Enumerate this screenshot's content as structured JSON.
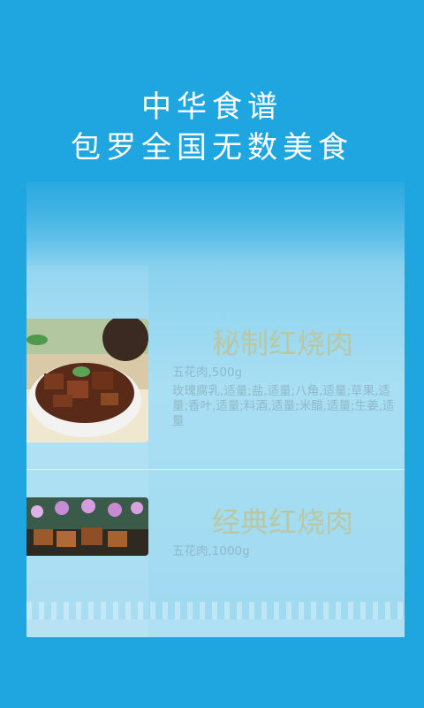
{
  "headline": {
    "line1": "中华食谱",
    "line2": "包罗全国无数美食"
  },
  "recipes": [
    {
      "title": "秘制红烧肉",
      "ingredient_main": "五花肉,500g",
      "ingredient_rest": "玫瑰腐乳,适量;盐,适量;八角,适量;草果,适量;香叶,适量;料酒,适量;米醋,适量;生姜,适量"
    },
    {
      "title": "经典红烧肉",
      "ingredient_main": "五花肉,1000g"
    }
  ],
  "colors": {
    "background": "#1fa6e0",
    "title_text": "#b9c7a3",
    "ingredient_text": "#8fb9c9"
  }
}
